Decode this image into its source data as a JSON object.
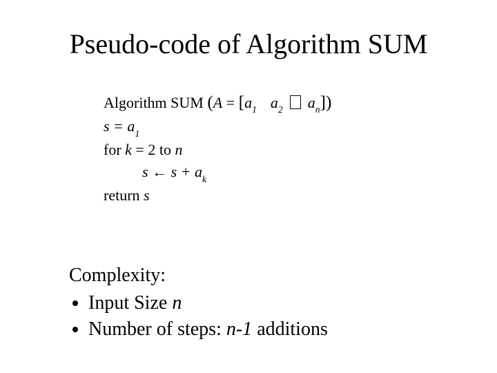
{
  "title": "Pseudo-code of Algorithm SUM",
  "algo": {
    "head_prefix": "Algorithm SUM ",
    "lparen": "(",
    "A": "A",
    "eq": " = ",
    "lbr": "[",
    "a": "a",
    "sub1": "1",
    "sub2": "2",
    "subn": "n",
    "subk": "k",
    "rbr": "]",
    "rparen": ")",
    "line_s_eq": "s = a",
    "line_for_1": "for ",
    "line_for_k": "k",
    "line_for_eq": "  =  2 to ",
    "line_for_n": "n",
    "line_assign_s": "s",
    "line_assign_arrow": " ← ",
    "line_assign_rhs1": "s + a",
    "line_return": "return ",
    "line_return_s": "s"
  },
  "complexity": {
    "heading": "Complexity:",
    "b1_pre": "Input Size  ",
    "b1_var": "n",
    "b2_pre": "Number of steps: ",
    "b2_var": "n-1",
    "b2_post": " additions"
  }
}
